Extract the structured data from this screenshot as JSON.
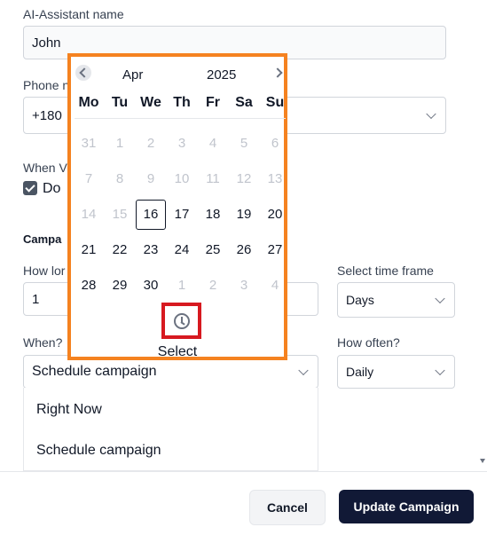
{
  "form": {
    "ai_name_label": "AI-Assistant name",
    "ai_name_value": "John",
    "phone_label": "Phone n",
    "phone_value": "+180",
    "when_v_label": "When V",
    "checkbox_label": "Do",
    "campaign_label": "Campa",
    "how_long_label": "How lor",
    "how_long_value": "1",
    "time_frame_label": "Select time frame",
    "time_frame_value": "Days",
    "when_label": "When?",
    "when_value": "Schedule campaign",
    "how_often_label": "How often?",
    "how_often_value": "Daily"
  },
  "when_options": [
    "Right Now",
    "Schedule campaign"
  ],
  "calendar": {
    "month": "Apr",
    "year": "2025",
    "weekdays": [
      "Mo",
      "Tu",
      "We",
      "Th",
      "Fr",
      "Sa",
      "Su"
    ],
    "weeks": [
      [
        "31",
        "1",
        "2",
        "3",
        "4",
        "5",
        "6"
      ],
      [
        "7",
        "8",
        "9",
        "10",
        "11",
        "12",
        "13"
      ],
      [
        "14",
        "15",
        "16",
        "17",
        "18",
        "19",
        "20"
      ],
      [
        "21",
        "22",
        "23",
        "24",
        "25",
        "26",
        "27"
      ],
      [
        "28",
        "29",
        "30",
        "1",
        "2",
        "3",
        "4"
      ]
    ],
    "selected_day": "16",
    "select_label": "Select"
  },
  "footer": {
    "cancel_label": "Cancel",
    "update_label": "Update Campaign"
  },
  "colors": {
    "highlight_orange": "#f58220",
    "highlight_red": "#d71920",
    "primary_button": "#111936"
  }
}
